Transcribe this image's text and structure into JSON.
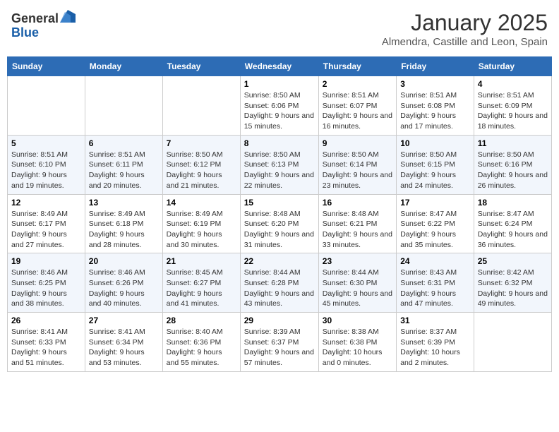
{
  "header": {
    "logo_general": "General",
    "logo_blue": "Blue",
    "month": "January 2025",
    "location": "Almendra, Castille and Leon, Spain"
  },
  "weekdays": [
    "Sunday",
    "Monday",
    "Tuesday",
    "Wednesday",
    "Thursday",
    "Friday",
    "Saturday"
  ],
  "weeks": [
    [
      {
        "day": "",
        "info": ""
      },
      {
        "day": "",
        "info": ""
      },
      {
        "day": "",
        "info": ""
      },
      {
        "day": "1",
        "info": "Sunrise: 8:50 AM\nSunset: 6:06 PM\nDaylight: 9 hours and 15 minutes."
      },
      {
        "day": "2",
        "info": "Sunrise: 8:51 AM\nSunset: 6:07 PM\nDaylight: 9 hours and 16 minutes."
      },
      {
        "day": "3",
        "info": "Sunrise: 8:51 AM\nSunset: 6:08 PM\nDaylight: 9 hours and 17 minutes."
      },
      {
        "day": "4",
        "info": "Sunrise: 8:51 AM\nSunset: 6:09 PM\nDaylight: 9 hours and 18 minutes."
      }
    ],
    [
      {
        "day": "5",
        "info": "Sunrise: 8:51 AM\nSunset: 6:10 PM\nDaylight: 9 hours and 19 minutes."
      },
      {
        "day": "6",
        "info": "Sunrise: 8:51 AM\nSunset: 6:11 PM\nDaylight: 9 hours and 20 minutes."
      },
      {
        "day": "7",
        "info": "Sunrise: 8:50 AM\nSunset: 6:12 PM\nDaylight: 9 hours and 21 minutes."
      },
      {
        "day": "8",
        "info": "Sunrise: 8:50 AM\nSunset: 6:13 PM\nDaylight: 9 hours and 22 minutes."
      },
      {
        "day": "9",
        "info": "Sunrise: 8:50 AM\nSunset: 6:14 PM\nDaylight: 9 hours and 23 minutes."
      },
      {
        "day": "10",
        "info": "Sunrise: 8:50 AM\nSunset: 6:15 PM\nDaylight: 9 hours and 24 minutes."
      },
      {
        "day": "11",
        "info": "Sunrise: 8:50 AM\nSunset: 6:16 PM\nDaylight: 9 hours and 26 minutes."
      }
    ],
    [
      {
        "day": "12",
        "info": "Sunrise: 8:49 AM\nSunset: 6:17 PM\nDaylight: 9 hours and 27 minutes."
      },
      {
        "day": "13",
        "info": "Sunrise: 8:49 AM\nSunset: 6:18 PM\nDaylight: 9 hours and 28 minutes."
      },
      {
        "day": "14",
        "info": "Sunrise: 8:49 AM\nSunset: 6:19 PM\nDaylight: 9 hours and 30 minutes."
      },
      {
        "day": "15",
        "info": "Sunrise: 8:48 AM\nSunset: 6:20 PM\nDaylight: 9 hours and 31 minutes."
      },
      {
        "day": "16",
        "info": "Sunrise: 8:48 AM\nSunset: 6:21 PM\nDaylight: 9 hours and 33 minutes."
      },
      {
        "day": "17",
        "info": "Sunrise: 8:47 AM\nSunset: 6:22 PM\nDaylight: 9 hours and 35 minutes."
      },
      {
        "day": "18",
        "info": "Sunrise: 8:47 AM\nSunset: 6:24 PM\nDaylight: 9 hours and 36 minutes."
      }
    ],
    [
      {
        "day": "19",
        "info": "Sunrise: 8:46 AM\nSunset: 6:25 PM\nDaylight: 9 hours and 38 minutes."
      },
      {
        "day": "20",
        "info": "Sunrise: 8:46 AM\nSunset: 6:26 PM\nDaylight: 9 hours and 40 minutes."
      },
      {
        "day": "21",
        "info": "Sunrise: 8:45 AM\nSunset: 6:27 PM\nDaylight: 9 hours and 41 minutes."
      },
      {
        "day": "22",
        "info": "Sunrise: 8:44 AM\nSunset: 6:28 PM\nDaylight: 9 hours and 43 minutes."
      },
      {
        "day": "23",
        "info": "Sunrise: 8:44 AM\nSunset: 6:30 PM\nDaylight: 9 hours and 45 minutes."
      },
      {
        "day": "24",
        "info": "Sunrise: 8:43 AM\nSunset: 6:31 PM\nDaylight: 9 hours and 47 minutes."
      },
      {
        "day": "25",
        "info": "Sunrise: 8:42 AM\nSunset: 6:32 PM\nDaylight: 9 hours and 49 minutes."
      }
    ],
    [
      {
        "day": "26",
        "info": "Sunrise: 8:41 AM\nSunset: 6:33 PM\nDaylight: 9 hours and 51 minutes."
      },
      {
        "day": "27",
        "info": "Sunrise: 8:41 AM\nSunset: 6:34 PM\nDaylight: 9 hours and 53 minutes."
      },
      {
        "day": "28",
        "info": "Sunrise: 8:40 AM\nSunset: 6:36 PM\nDaylight: 9 hours and 55 minutes."
      },
      {
        "day": "29",
        "info": "Sunrise: 8:39 AM\nSunset: 6:37 PM\nDaylight: 9 hours and 57 minutes."
      },
      {
        "day": "30",
        "info": "Sunrise: 8:38 AM\nSunset: 6:38 PM\nDaylight: 10 hours and 0 minutes."
      },
      {
        "day": "31",
        "info": "Sunrise: 8:37 AM\nSunset: 6:39 PM\nDaylight: 10 hours and 2 minutes."
      },
      {
        "day": "",
        "info": ""
      }
    ]
  ]
}
